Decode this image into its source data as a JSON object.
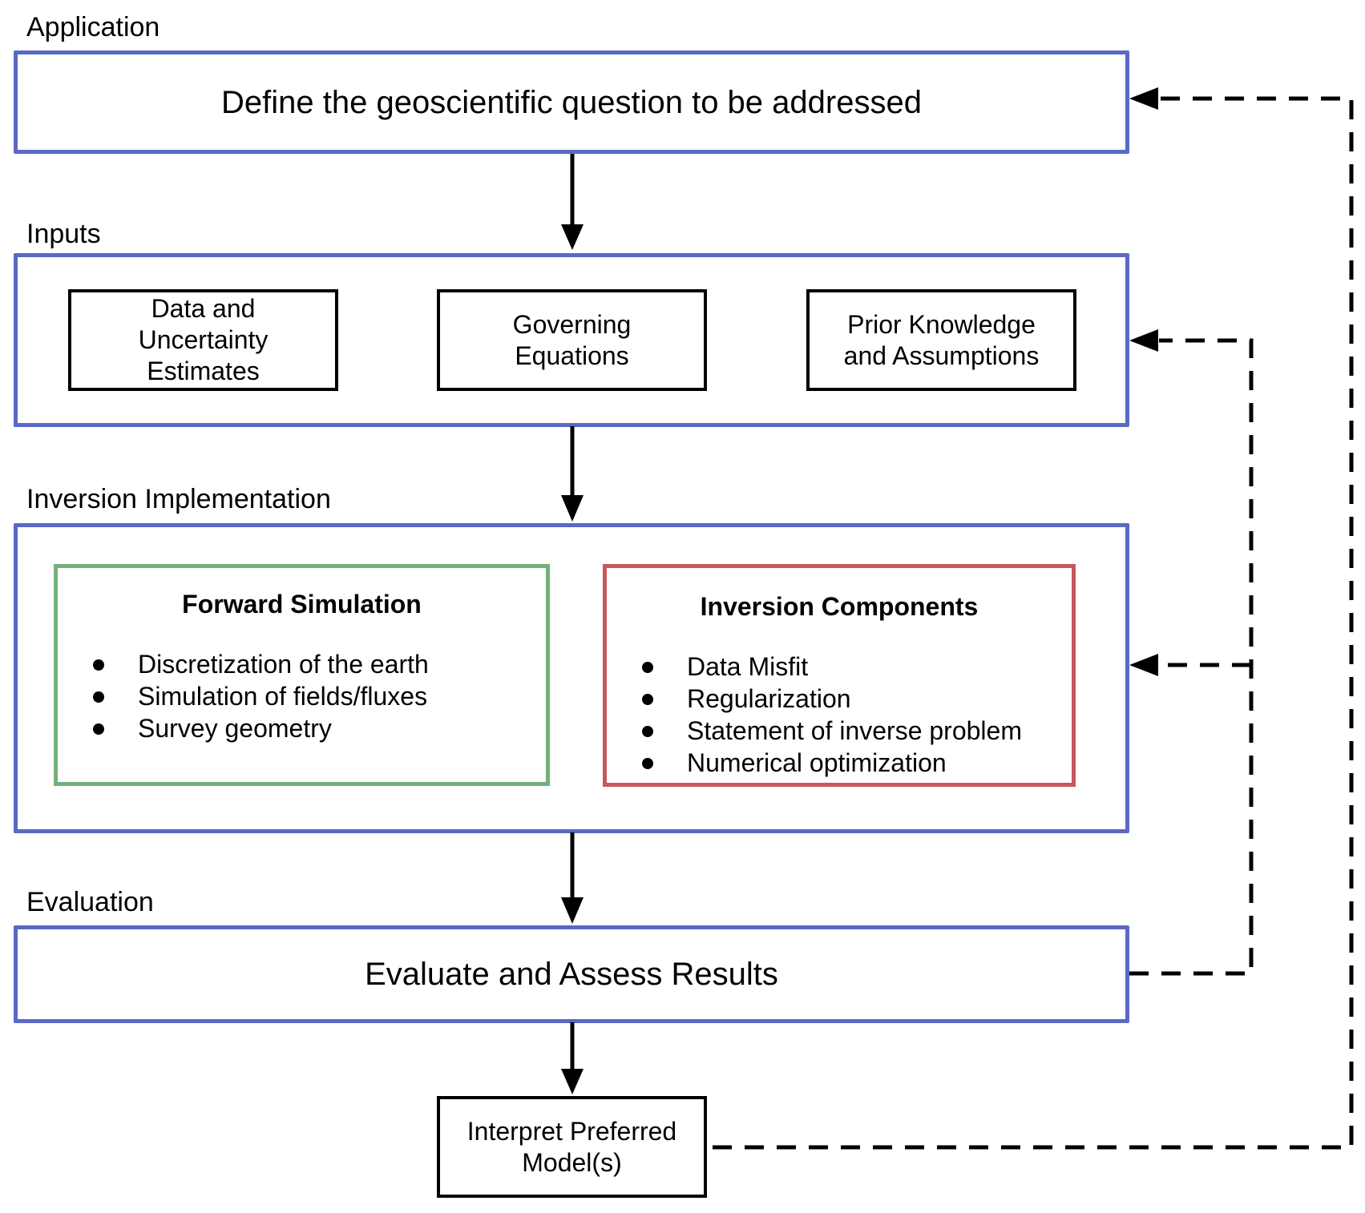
{
  "sections": {
    "application": {
      "label": "Application",
      "box_text": "Define the geoscientific question to be addressed"
    },
    "inputs": {
      "label": "Inputs",
      "items": [
        {
          "lines": [
            "Data and",
            "Uncertainty",
            "Estimates"
          ]
        },
        {
          "lines": [
            "Governing",
            "Equations"
          ]
        },
        {
          "lines": [
            "Prior Knowledge",
            "and Assumptions"
          ]
        }
      ]
    },
    "inversion": {
      "label": "Inversion Implementation",
      "forward_simulation": {
        "title": "Forward Simulation",
        "bullets": [
          "Discretization of the earth",
          "Simulation of fields/fluxes",
          "Survey geometry"
        ]
      },
      "inversion_components": {
        "title": "Inversion Components",
        "bullets": [
          "Data Misfit",
          "Regularization",
          "Statement of inverse problem",
          "Numerical optimization"
        ]
      }
    },
    "evaluation": {
      "label": "Evaluation",
      "box_text": "Evaluate and Assess Results"
    },
    "interpret": {
      "lines": [
        "Interpret Preferred",
        "Model(s)"
      ]
    }
  },
  "colors": {
    "section_border": "#5b68c4",
    "forward_border": "#74b07a",
    "inversion_border": "#c8575c",
    "arrow": "#000000"
  },
  "connectors": [
    {
      "from": "application",
      "to": "inputs",
      "style": "solid"
    },
    {
      "from": "inputs",
      "to": "inversion",
      "style": "solid"
    },
    {
      "from": "inversion",
      "to": "evaluation",
      "style": "solid"
    },
    {
      "from": "evaluation",
      "to": "interpret",
      "style": "solid"
    },
    {
      "from": "evaluation",
      "to": "inputs",
      "style": "dashed"
    },
    {
      "from": "evaluation",
      "to": "inversion",
      "style": "dashed"
    },
    {
      "from": "interpret",
      "to": "application",
      "style": "dashed"
    }
  ]
}
